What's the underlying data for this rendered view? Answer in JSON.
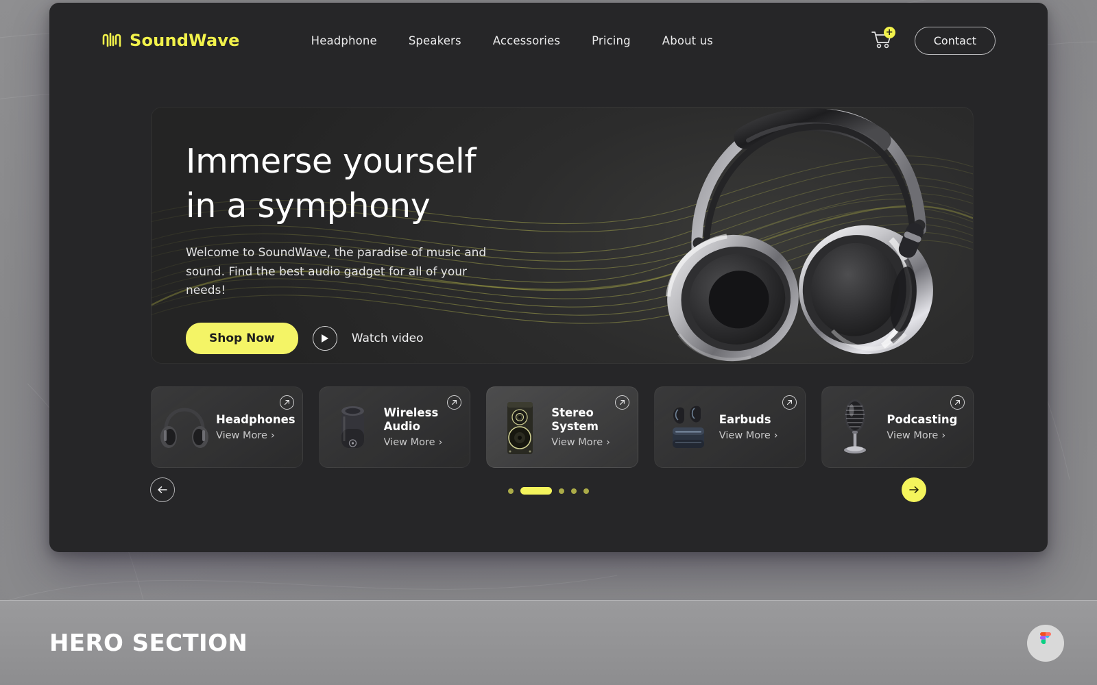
{
  "brand": {
    "name": "SoundWave",
    "logo_icon": "waveform-icon",
    "accent_color": "#f2f24b"
  },
  "nav": {
    "items": [
      {
        "label": "Headphone"
      },
      {
        "label": "Speakers"
      },
      {
        "label": "Accessories"
      },
      {
        "label": "Pricing"
      },
      {
        "label": "About us"
      }
    ],
    "cart": {
      "icon": "shopping-cart-icon",
      "badge": "+"
    },
    "contact_label": "Contact"
  },
  "hero": {
    "title": "Immerse yourself\nin a symphony",
    "subtitle": "Welcome to SoundWave, the paradise of music and sound. Find the best audio gadget for all of your needs!",
    "shop_label": "Shop Now",
    "watch_label": "Watch video",
    "play_icon": "play-icon",
    "product_image": "silver-over-ear-headphones"
  },
  "categories": {
    "view_more_label": "View More",
    "arrow_icon": "arrow-up-right-icon",
    "items": [
      {
        "title": "Headphones",
        "thumb": "headphones-thumb",
        "active": false
      },
      {
        "title": "Wireless\nAudio",
        "thumb": "bluetooth-speaker-thumb",
        "active": false
      },
      {
        "title": "Stereo\nSystem",
        "thumb": "stereo-speaker-thumb",
        "active": true
      },
      {
        "title": "Earbuds",
        "thumb": "earbuds-case-thumb",
        "active": false
      },
      {
        "title": "Podcasting",
        "thumb": "microphone-thumb",
        "active": false
      }
    ]
  },
  "carousel": {
    "prev_icon": "arrow-left-icon",
    "next_icon": "arrow-right-icon",
    "dots": [
      {
        "active": false
      },
      {
        "active": true
      },
      {
        "active": false
      },
      {
        "active": false
      },
      {
        "active": false
      }
    ]
  },
  "footer": {
    "caption": "HERO SECTION",
    "badge_icon": "figma-icon"
  }
}
